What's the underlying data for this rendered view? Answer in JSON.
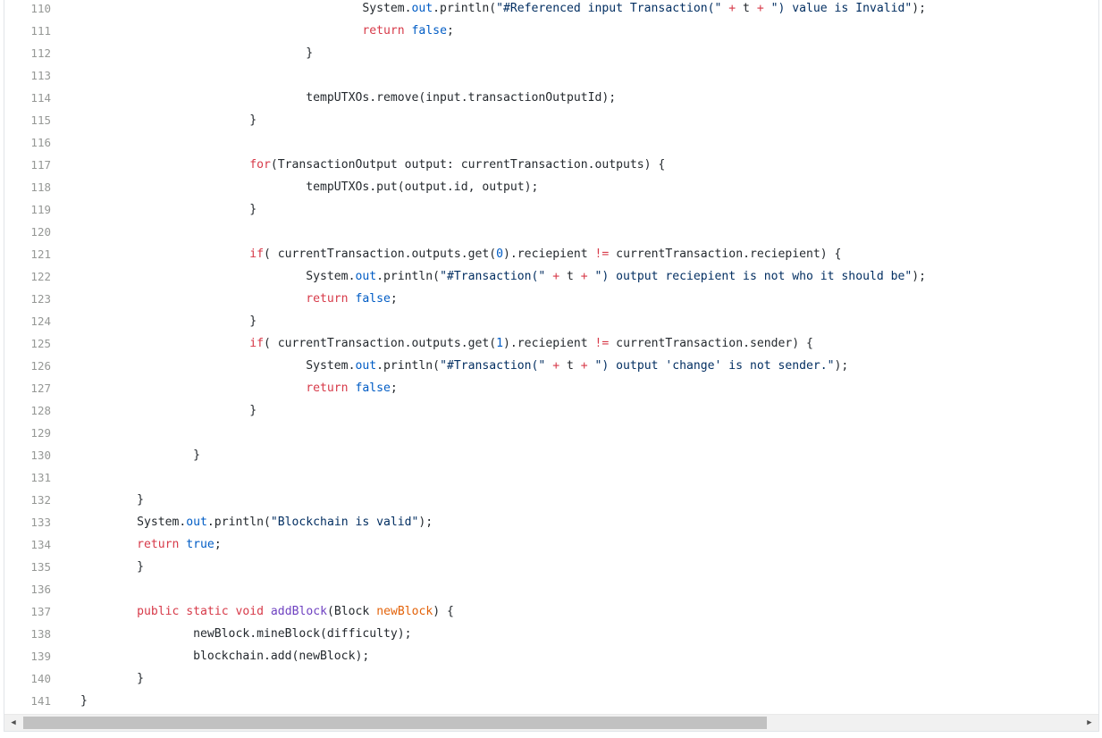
{
  "code_view": {
    "lines": [
      {
        "n": "110",
        "parts": [
          [
            "",
            "                                        "
          ],
          [
            "",
            "System."
          ],
          [
            "tp",
            "out"
          ],
          [
            "",
            ".println("
          ],
          [
            "st",
            "\"#Referenced input Transaction(\""
          ],
          [
            "op",
            " + "
          ],
          [
            "",
            "t"
          ],
          [
            "op",
            " + "
          ],
          [
            "st",
            "\") value is Invalid\""
          ],
          [
            "",
            ");"
          ]
        ]
      },
      {
        "n": "111",
        "parts": [
          [
            "",
            "                                        "
          ],
          [
            "kw",
            "return"
          ],
          [
            "",
            " "
          ],
          [
            "tp",
            "false"
          ],
          [
            "",
            ";"
          ]
        ]
      },
      {
        "n": "112",
        "parts": [
          [
            "",
            "                                "
          ],
          [
            "",
            "}"
          ]
        ]
      },
      {
        "n": "113",
        "parts": []
      },
      {
        "n": "114",
        "parts": [
          [
            "",
            "                                "
          ],
          [
            "",
            "tempUTXOs.remove(input.transactionOutputId);"
          ]
        ]
      },
      {
        "n": "115",
        "parts": [
          [
            "",
            "                        "
          ],
          [
            "",
            "}"
          ]
        ]
      },
      {
        "n": "116",
        "parts": []
      },
      {
        "n": "117",
        "parts": [
          [
            "",
            "                        "
          ],
          [
            "kw",
            "for"
          ],
          [
            "",
            "(TransactionOutput output: currentTransaction.outputs) {"
          ]
        ]
      },
      {
        "n": "118",
        "parts": [
          [
            "",
            "                                "
          ],
          [
            "",
            "tempUTXOs.put(output.id, output);"
          ]
        ]
      },
      {
        "n": "119",
        "parts": [
          [
            "",
            "                        "
          ],
          [
            "",
            "}"
          ]
        ]
      },
      {
        "n": "120",
        "parts": []
      },
      {
        "n": "121",
        "parts": [
          [
            "",
            "                        "
          ],
          [
            "kw",
            "if"
          ],
          [
            "",
            "( currentTransaction.outputs.get("
          ],
          [
            "tp",
            "0"
          ],
          [
            "",
            ").reciepient "
          ],
          [
            "op",
            "!="
          ],
          [
            "",
            " currentTransaction.reciepient) {"
          ]
        ]
      },
      {
        "n": "122",
        "parts": [
          [
            "",
            "                                "
          ],
          [
            "",
            "System."
          ],
          [
            "tp",
            "out"
          ],
          [
            "",
            ".println("
          ],
          [
            "st",
            "\"#Transaction(\""
          ],
          [
            "op",
            " + "
          ],
          [
            "",
            "t"
          ],
          [
            "op",
            " + "
          ],
          [
            "st",
            "\") output reciepient is not who it should be\""
          ],
          [
            "",
            ");"
          ]
        ]
      },
      {
        "n": "123",
        "parts": [
          [
            "",
            "                                "
          ],
          [
            "kw",
            "return"
          ],
          [
            "",
            " "
          ],
          [
            "tp",
            "false"
          ],
          [
            "",
            ";"
          ]
        ]
      },
      {
        "n": "124",
        "parts": [
          [
            "",
            "                        "
          ],
          [
            "",
            "}"
          ]
        ]
      },
      {
        "n": "125",
        "parts": [
          [
            "",
            "                        "
          ],
          [
            "kw",
            "if"
          ],
          [
            "",
            "( currentTransaction.outputs.get("
          ],
          [
            "tp",
            "1"
          ],
          [
            "",
            ").reciepient "
          ],
          [
            "op",
            "!="
          ],
          [
            "",
            " currentTransaction.sender) {"
          ]
        ]
      },
      {
        "n": "126",
        "parts": [
          [
            "",
            "                                "
          ],
          [
            "",
            "System."
          ],
          [
            "tp",
            "out"
          ],
          [
            "",
            ".println("
          ],
          [
            "st",
            "\"#Transaction(\""
          ],
          [
            "op",
            " + "
          ],
          [
            "",
            "t"
          ],
          [
            "op",
            " + "
          ],
          [
            "st",
            "\") output 'change' is not sender.\""
          ],
          [
            "",
            ");"
          ]
        ]
      },
      {
        "n": "127",
        "parts": [
          [
            "",
            "                                "
          ],
          [
            "kw",
            "return"
          ],
          [
            "",
            " "
          ],
          [
            "tp",
            "false"
          ],
          [
            "",
            ";"
          ]
        ]
      },
      {
        "n": "128",
        "parts": [
          [
            "",
            "                        "
          ],
          [
            "",
            "}"
          ]
        ]
      },
      {
        "n": "129",
        "parts": []
      },
      {
        "n": "130",
        "parts": [
          [
            "",
            "                "
          ],
          [
            "",
            "}"
          ]
        ]
      },
      {
        "n": "131",
        "parts": []
      },
      {
        "n": "132",
        "parts": [
          [
            "",
            "        "
          ],
          [
            "",
            "}"
          ]
        ]
      },
      {
        "n": "133",
        "parts": [
          [
            "",
            "        "
          ],
          [
            "",
            "System."
          ],
          [
            "tp",
            "out"
          ],
          [
            "",
            ".println("
          ],
          [
            "st",
            "\"Blockchain is valid\""
          ],
          [
            "",
            ");"
          ]
        ]
      },
      {
        "n": "134",
        "parts": [
          [
            "",
            "        "
          ],
          [
            "kw",
            "return"
          ],
          [
            "",
            " "
          ],
          [
            "tp",
            "true"
          ],
          [
            "",
            ";"
          ]
        ]
      },
      {
        "n": "135",
        "parts": [
          [
            "",
            "        "
          ],
          [
            "",
            "}"
          ]
        ]
      },
      {
        "n": "136",
        "parts": []
      },
      {
        "n": "137",
        "parts": [
          [
            "",
            "        "
          ],
          [
            "kw",
            "public"
          ],
          [
            "",
            " "
          ],
          [
            "kw",
            "static"
          ],
          [
            "",
            " "
          ],
          [
            "kw",
            "void"
          ],
          [
            "",
            " "
          ],
          [
            "fn",
            "addBlock"
          ],
          [
            "",
            "(Block "
          ],
          [
            "pa",
            "newBlock"
          ],
          [
            "",
            ") {"
          ]
        ]
      },
      {
        "n": "138",
        "parts": [
          [
            "",
            "                "
          ],
          [
            "",
            "newBlock.mineBlock(difficulty);"
          ]
        ]
      },
      {
        "n": "139",
        "parts": [
          [
            "",
            "                "
          ],
          [
            "",
            "blockchain.add(newBlock);"
          ]
        ]
      },
      {
        "n": "140",
        "parts": [
          [
            "",
            "        "
          ],
          [
            "",
            "}"
          ]
        ]
      },
      {
        "n": "141",
        "parts": [
          [
            "",
            "}"
          ]
        ]
      }
    ]
  },
  "scrollbar": {
    "left_arrow_icon": "triangle-left-icon",
    "right_arrow_icon": "triangle-right-icon",
    "left_glyph": "◀",
    "right_glyph": "▶",
    "position_fraction": 0.0,
    "visible_fraction": 0.69
  }
}
